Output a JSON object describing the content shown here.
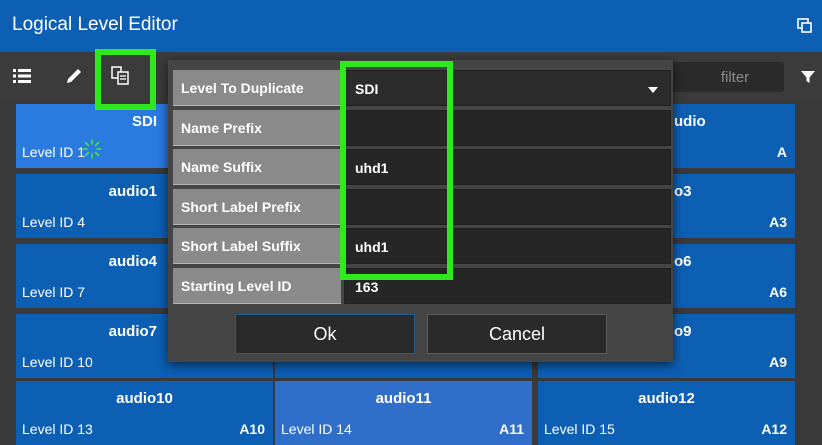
{
  "window": {
    "title": "Logical Level Editor",
    "restore_icon": "restore-window-icon"
  },
  "toolbar": {
    "list_icon": "list-icon",
    "edit_icon": "pencil-icon",
    "duplicate_icon": "duplicate-icon",
    "filter_placeholder": "filter",
    "filter_icon": "funnel-icon"
  },
  "levels": [
    {
      "name": "SDI",
      "level_id": "Level ID 1",
      "short": ""
    },
    {
      "name": "",
      "level_id": "",
      "short": ""
    },
    {
      "name": "udio",
      "level_id": "",
      "short": "A"
    },
    {
      "name": "audio1",
      "level_id": "Level ID 4",
      "short": ""
    },
    {
      "name": "",
      "level_id": "",
      "short": ""
    },
    {
      "name": "o3",
      "level_id": "",
      "short": "A3"
    },
    {
      "name": "audio4",
      "level_id": "Level ID 7",
      "short": ""
    },
    {
      "name": "",
      "level_id": "",
      "short": ""
    },
    {
      "name": "o6",
      "level_id": "",
      "short": "A6"
    },
    {
      "name": "audio7",
      "level_id": "Level ID 10",
      "short": ""
    },
    {
      "name": "",
      "level_id": "",
      "short": ""
    },
    {
      "name": "o9",
      "level_id": "",
      "short": "A9"
    },
    {
      "name": "audio10",
      "level_id": "Level ID 13",
      "short": "A10"
    },
    {
      "name": "audio11",
      "level_id": "Level ID 14",
      "short": "A11"
    },
    {
      "name": "audio12",
      "level_id": "Level ID 15",
      "short": "A12"
    }
  ],
  "dialog": {
    "fields": [
      {
        "label": "Level To Duplicate",
        "value": "SDI",
        "type": "dropdown"
      },
      {
        "label": "Name Prefix",
        "value": ""
      },
      {
        "label": "Name Suffix",
        "value": "uhd1"
      },
      {
        "label": "Short Label Prefix",
        "value": ""
      },
      {
        "label": "Short Label Suffix",
        "value": "uhd1"
      },
      {
        "label": "Starting Level ID",
        "value": "163"
      }
    ],
    "ok_label": "Ok",
    "cancel_label": "Cancel"
  },
  "colors": {
    "header_blue": "#0d5fb4",
    "selected_blue": "#2a7ae0",
    "highlight_green": "#2fe81e"
  }
}
